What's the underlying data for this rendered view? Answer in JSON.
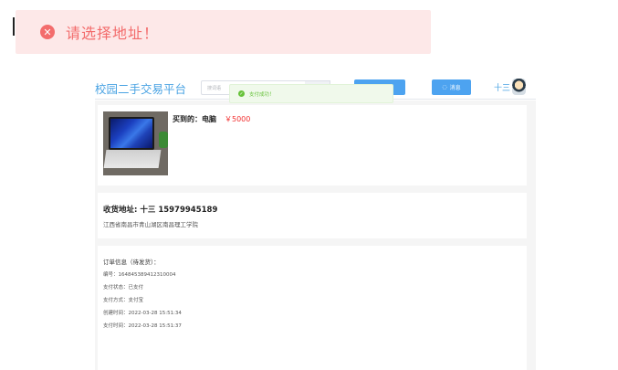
{
  "error_toast": {
    "message": "请选择地址！",
    "icon": "close-icon"
  },
  "header": {
    "brand": "校园二手交易平台",
    "search_placeholder": "搜词语",
    "user_name": "十三",
    "message_button": "消息"
  },
  "success_toast": {
    "message": "支付成功！",
    "icon": "check-icon"
  },
  "product": {
    "bought_label": "买到的：",
    "name": "电脑",
    "price": "￥5000"
  },
  "address": {
    "title": "收货地址: 十三 15979945189",
    "detail": "江西省南昌市青山湖区南昌理工学院"
  },
  "order": {
    "title": "订单信息（待发货）：",
    "lines": [
      "编号：164845389412310004",
      "支付状态：已支付",
      "支付方式：支付宝",
      "创建时间：2022-03-28 15:51:34",
      "支付时间：2022-03-28 15:51:37"
    ]
  },
  "colors": {
    "accent": "#4da3f0",
    "error": "#f36c6c",
    "success": "#67c23a",
    "price": "#f23030"
  }
}
